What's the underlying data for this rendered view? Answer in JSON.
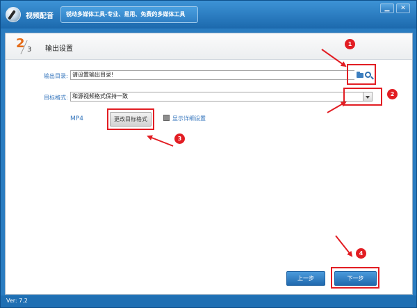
{
  "window": {
    "title": "视频配音",
    "slogan": "锐动多媒体工具-专业、易用、免费的多媒体工具",
    "minimize_glyph": "▁",
    "close_glyph": "✕"
  },
  "step": {
    "current": "2",
    "total": "3",
    "title": "输出设置"
  },
  "form": {
    "output_dir_label": "输出目录:",
    "output_dir_value": "请设置输出目录!",
    "target_format_label": "目标格式:",
    "target_format_value": "和源视频格式保持一致",
    "current_format": "MP4",
    "change_format_button": "更改目标格式",
    "show_details_label": "显示详细设置",
    "show_details_checked": false
  },
  "footer": {
    "prev_button": "上一步",
    "next_button": "下一步",
    "version": "Ver: 7.2"
  },
  "annotations": [
    "1",
    "2",
    "3",
    "4"
  ],
  "colors": {
    "title_bar": "#2a7cc0",
    "accent_orange": "#e46a16",
    "label_blue": "#3576bd",
    "annotation_red": "#e21d23"
  },
  "icons": [
    "folder-icon",
    "search-icon",
    "chevron-down-icon",
    "app-logo"
  ]
}
